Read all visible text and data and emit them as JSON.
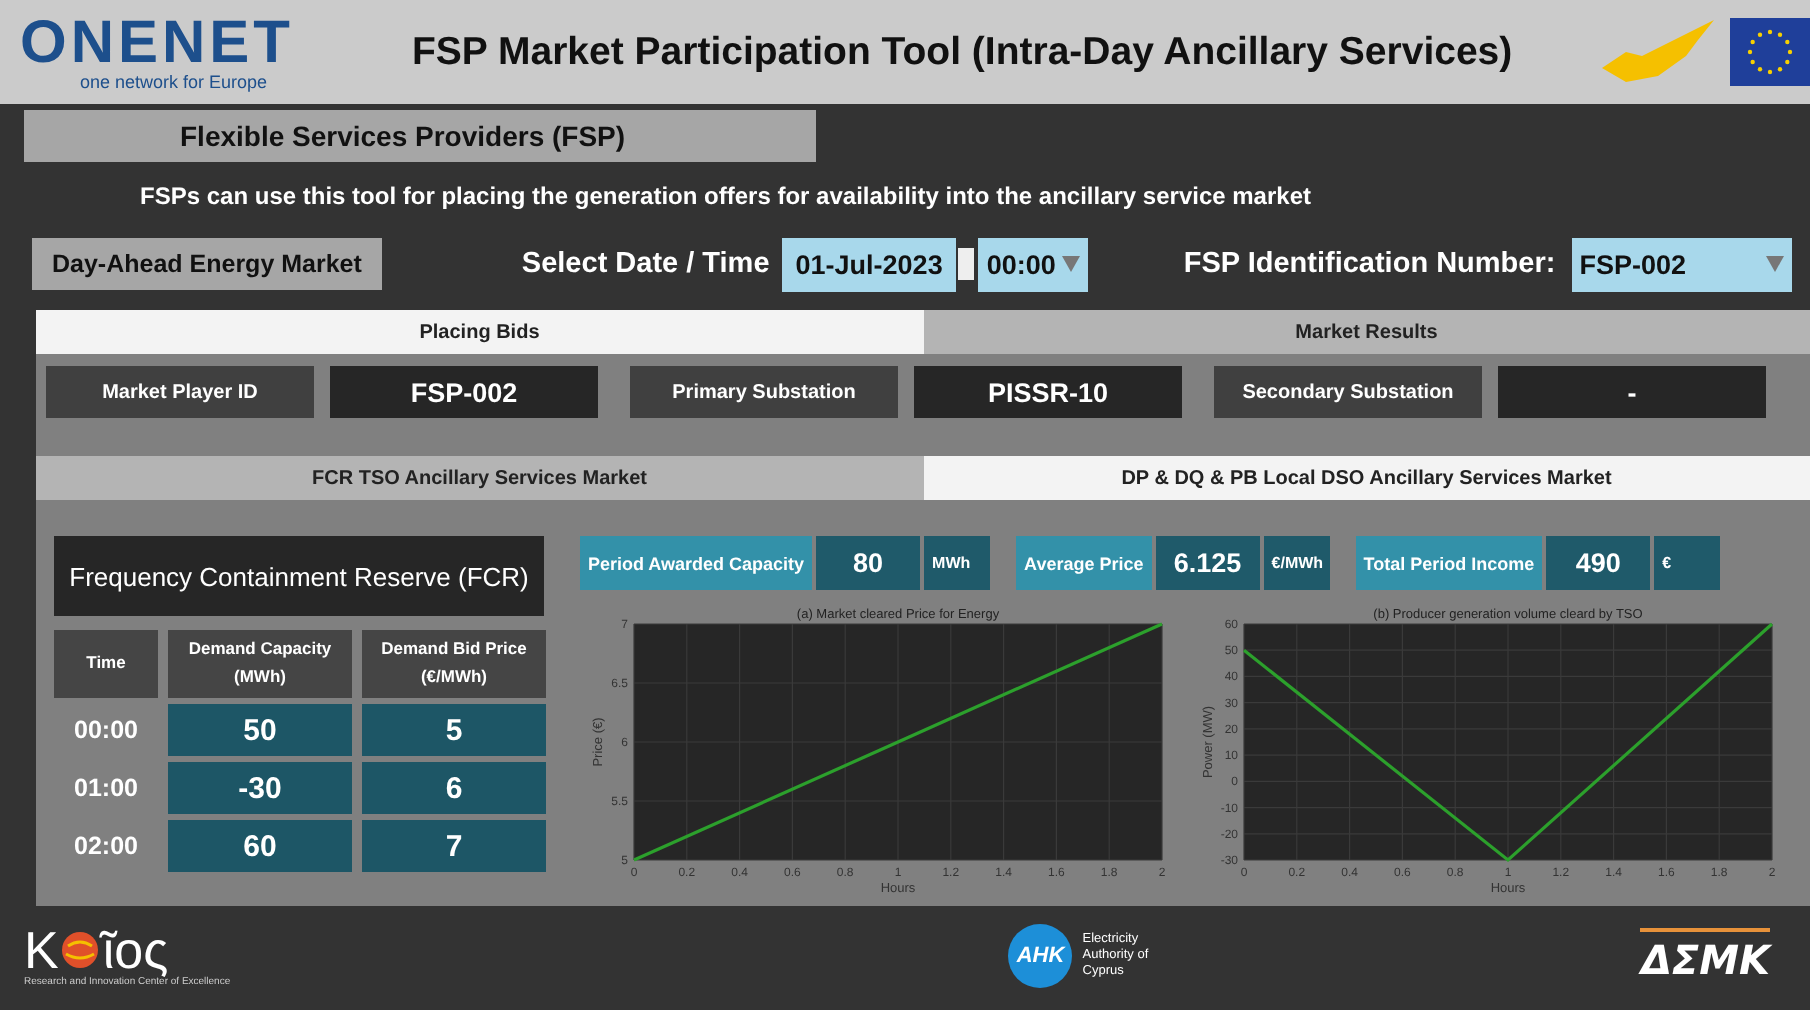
{
  "header": {
    "logo_name": "ONENET",
    "logo_tagline": "one network for Europe",
    "title": "FSP Market Participation Tool (Intra-Day Ancillary Services)"
  },
  "section_title": "Flexible Services Providers (FSP)",
  "description": "FSPs can use this tool for placing the generation offers for availability into the ancillary service market",
  "controls": {
    "market_button": "Day-Ahead Energy Market",
    "date_label": "Select Date / Time",
    "date": "01-Jul-2023",
    "time": "00:00",
    "fsp_label": "FSP Identification Number:",
    "fsp_id": "FSP-002"
  },
  "tabs": [
    {
      "label": "Placing Bids",
      "selected": true
    },
    {
      "label": "Market Results",
      "selected": false
    }
  ],
  "info": [
    {
      "label": "Market Player ID",
      "value": "FSP-002"
    },
    {
      "label": "Primary Substation",
      "value": "PISSR-10"
    },
    {
      "label": "Secondary Substation",
      "value": "-"
    }
  ],
  "market_tabs": [
    {
      "label": "FCR TSO Ancillary Services Market",
      "selected": false
    },
    {
      "label": "DP & DQ & PB Local DSO Ancillary Services Market",
      "selected": true
    }
  ],
  "fcr": {
    "title": "Frequency Containment Reserve (FCR)",
    "columns": [
      "Time",
      "Demand Capacity (MWh)",
      "Demand Bid Price (€/MWh)"
    ],
    "rows": [
      {
        "time": "00:00",
        "capacity": "50",
        "price": "5"
      },
      {
        "time": "01:00",
        "capacity": "-30",
        "price": "6"
      },
      {
        "time": "02:00",
        "capacity": "60",
        "price": "7"
      }
    ]
  },
  "stats": [
    {
      "label": "Period Awarded Capacity",
      "value": "80",
      "unit": "MWh"
    },
    {
      "label": "Average Price",
      "value": "6.125",
      "unit": "€/MWh"
    },
    {
      "label": "Total Period Income",
      "value": "490",
      "unit": "€"
    }
  ],
  "charts": [
    {
      "chart_data": {
        "type": "line",
        "title": "(a) Market cleared Price for Energy",
        "xlabel": "Hours",
        "ylabel": "Price (€)",
        "x": [
          0,
          1,
          2
        ],
        "series": [
          {
            "color": "#2ca02c",
            "values": [
              5,
              6,
              7
            ]
          }
        ],
        "xlim": [
          0,
          2
        ],
        "ylim": [
          5,
          7
        ],
        "xticks": [
          0,
          0.2,
          0.4,
          0.6,
          0.8,
          1,
          1.2,
          1.4,
          1.6,
          1.8,
          2
        ],
        "yticks": [
          5,
          5.5,
          6,
          6.5,
          7
        ],
        "grid": true
      }
    },
    {
      "chart_data": {
        "type": "line",
        "title": "(b) Producer generation volume cleard by TSO",
        "xlabel": "Hours",
        "ylabel": "Power (MW)",
        "x": [
          0,
          1,
          2
        ],
        "series": [
          {
            "color": "#2ca02c",
            "values": [
              50,
              -30,
              60
            ]
          }
        ],
        "xlim": [
          0,
          2
        ],
        "ylim": [
          -30,
          60
        ],
        "xticks": [
          0,
          0.2,
          0.4,
          0.6,
          0.8,
          1,
          1.2,
          1.4,
          1.6,
          1.8,
          2
        ],
        "yticks": [
          -30,
          -20,
          -10,
          0,
          10,
          20,
          30,
          40,
          50,
          60
        ],
        "grid": true
      }
    }
  ],
  "footer": {
    "left_logo_start": "K",
    "left_logo_end": "ῖος",
    "left_tagline": "Research and Innovation Center of Excellence",
    "center_mark": "ΑΗΚ",
    "center_text": "Electricity Authority of Cyprus",
    "right_logo": "ΔΣΜΚ"
  }
}
